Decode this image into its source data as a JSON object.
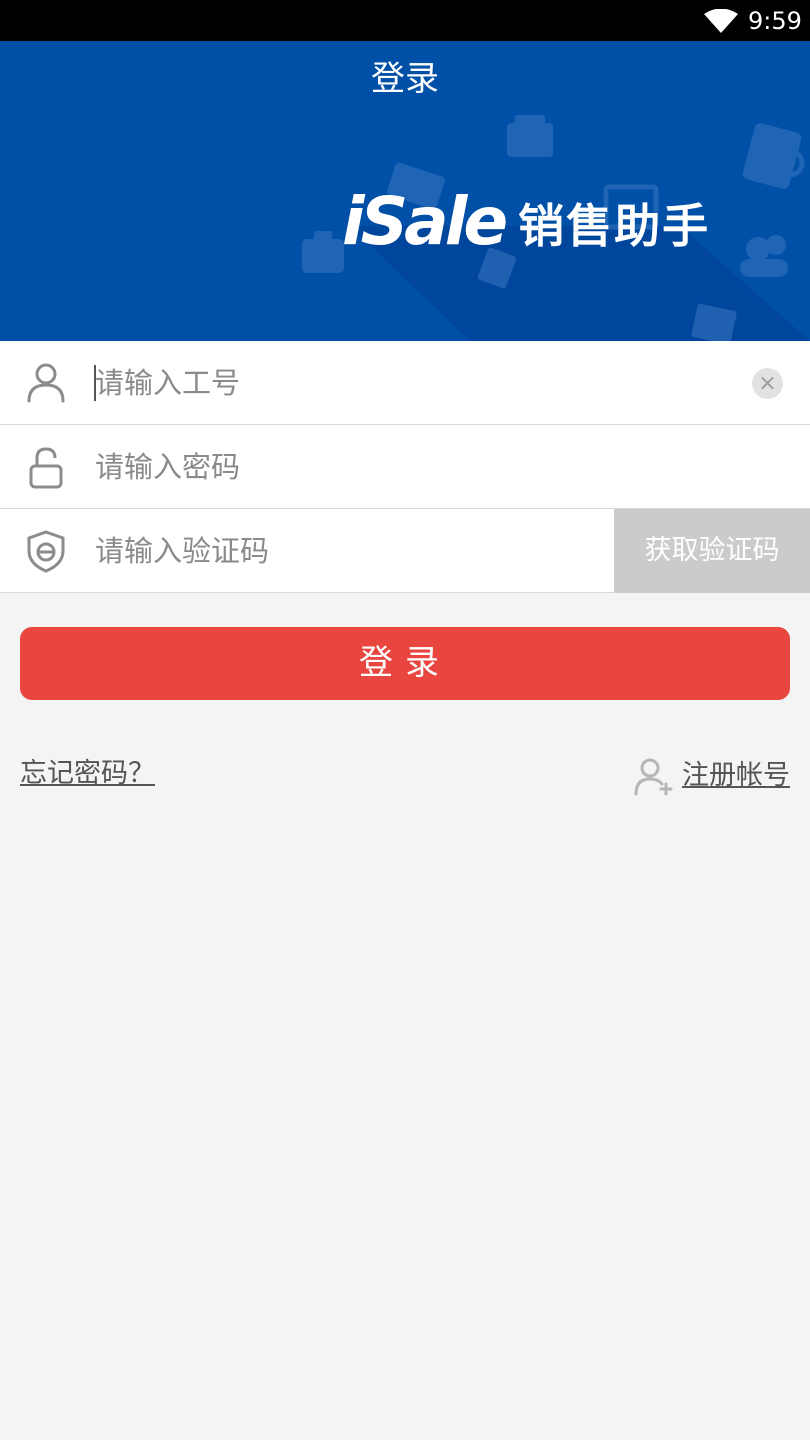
{
  "status_bar": {
    "time": "9:59",
    "wifi_icon": "wifi-icon"
  },
  "header": {
    "title": "登录",
    "logo_en": "iSale",
    "logo_cn": "销售助手",
    "background_color": "#0050a8"
  },
  "form": {
    "employee_id": {
      "placeholder": "请输入工号",
      "icon": "user-icon",
      "clear_icon": "clear-icon"
    },
    "password": {
      "placeholder": "请输入密码",
      "icon": "lock-icon"
    },
    "verification": {
      "placeholder": "请输入验证码",
      "icon": "shield-icon",
      "get_code_label": "获取验证码"
    }
  },
  "login_button": {
    "label": "登录",
    "color": "#e8463f"
  },
  "links": {
    "forgot_password": "忘记密码？",
    "register": "注册帐号",
    "register_icon": "add-user-icon"
  }
}
